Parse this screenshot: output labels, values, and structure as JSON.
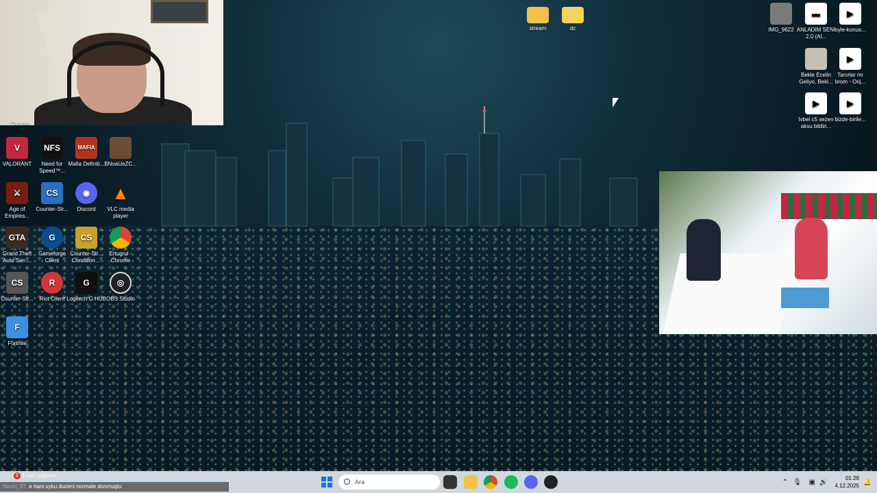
{
  "desktop": {
    "left_icons": [
      {
        "name": "chrome-top",
        "label": "Chrome"
      },
      {
        "name": "valorant",
        "label": "VALORANT",
        "color": "#c3283f"
      },
      {
        "name": "nfs",
        "label": "Need for Speed™...",
        "color": "#111111"
      },
      {
        "name": "mafia",
        "label": "Mafia Definiti...",
        "color": "#b3341c"
      },
      {
        "name": "bnoa",
        "label": "BNoaUeZC...",
        "color": "#6b4d35"
      },
      {
        "name": "aoe",
        "label": "Age of Empires...",
        "color": "#7a1d14"
      },
      {
        "name": "counter-strike-1",
        "label": "Counter-Str...",
        "color": "#2b6fc4"
      },
      {
        "name": "discord",
        "label": "Discord",
        "color": "#5865f2"
      },
      {
        "name": "vlc",
        "label": "VLC media player",
        "color": "#ff8800"
      },
      {
        "name": "gta",
        "label": "Grand Theft Auto San ...",
        "color": "#3a2c20"
      },
      {
        "name": "gameforge",
        "label": "Gameforge Client",
        "color": "#0a4d8f"
      },
      {
        "name": "counter-strike-condition",
        "label": "Counter-Str... Condition ...",
        "color": "#caa12c"
      },
      {
        "name": "ertugrul-chrome",
        "label": "Ertugrul - Chrome",
        "color": "#db4437"
      },
      {
        "name": "counter-strike-2",
        "label": "Counter-Str...",
        "color": "#555555"
      },
      {
        "name": "riot",
        "label": "Riot Client",
        "color": "#d13639"
      },
      {
        "name": "logitech",
        "label": "Logitech G HUB",
        "color": "#101010"
      },
      {
        "name": "obs",
        "label": "OBS Studio",
        "color": "#222222"
      },
      {
        "name": "fortnite",
        "label": "Fortnite",
        "color": "#3d8fe3"
      }
    ],
    "top_folders": [
      {
        "name": "stream",
        "label": "stream"
      },
      {
        "name": "dc",
        "label": "dc"
      }
    ],
    "right_icons": [
      {
        "name": "img-9622",
        "label": "IMG_9622"
      },
      {
        "name": "anladim",
        "label": "ANLADIM SENİ 2.0 (Al..."
      },
      {
        "name": "oyle-konus",
        "label": "oyle-konus..."
      },
      {
        "name": "bekle-ecelin",
        "label": "Bekle Ecelin Geliyo, Bekl..."
      },
      {
        "name": "tanirlar-mi",
        "label": "Tanırlar mı brom - Orij..."
      },
      {
        "name": "ivbel",
        "label": "Ivbel c5 sezen aksu bildiri..."
      },
      {
        "name": "bizde-birile",
        "label": "bizde-birile..."
      }
    ]
  },
  "chat": {
    "badge_count": "8",
    "weather": "1 mm yağmur",
    "user": "Havin_07:",
    "message": "e hani uyku duzeni normale donmuştu"
  },
  "taskbar": {
    "search_placeholder": "Ara",
    "time": "01:28",
    "date": "4.12.2025"
  }
}
